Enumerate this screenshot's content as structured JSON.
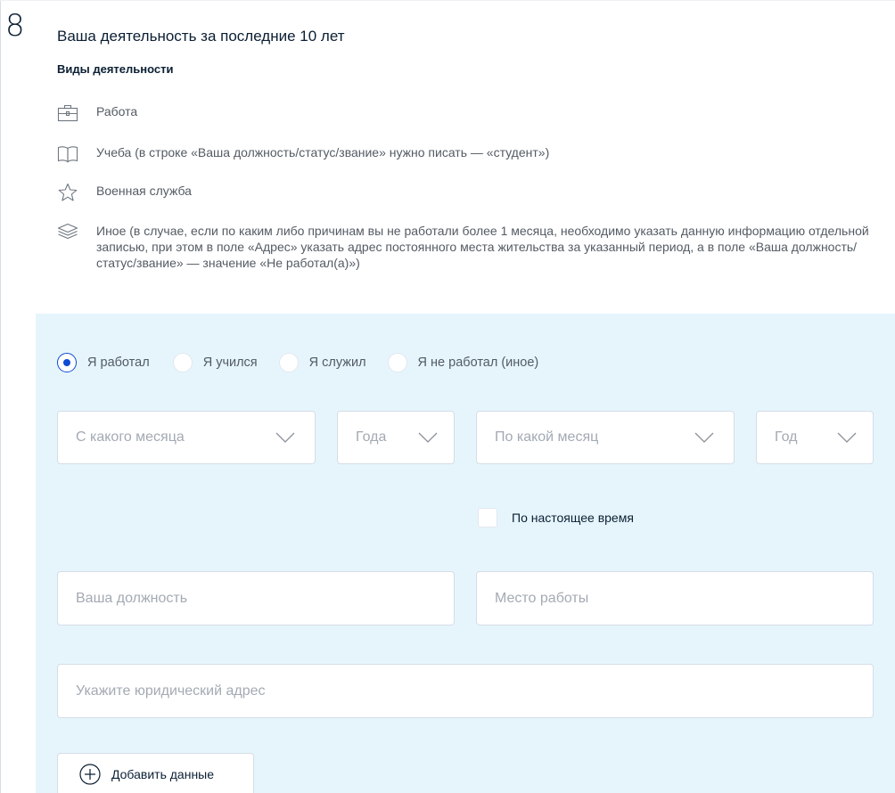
{
  "step": {
    "number": "8",
    "title": "Ваша деятельность за последние 10 лет"
  },
  "activity_types": {
    "heading": "Виды деятельности",
    "items": [
      {
        "icon": "briefcase-icon",
        "text": "Работа"
      },
      {
        "icon": "book-icon",
        "text": "Учеба (в строке «Ваша должность/статус/звание» нужно писать — «студент»)"
      },
      {
        "icon": "star-icon",
        "text": "Военная служба"
      },
      {
        "icon": "layers-icon",
        "text": "Иное (в случае, если по каким либо причинам вы не работали более 1 месяца, необходимо указать данную информацию отдельной записью, при этом в поле «Адрес» указать адрес постоянного места жительства за указанный период, а в поле «Ваша должность/статус/звание» — значение «Не работал(а)»)"
      }
    ]
  },
  "form": {
    "activity_options": [
      {
        "label": "Я работал",
        "checked": true
      },
      {
        "label": "Я учился",
        "checked": false
      },
      {
        "label": "Я служил",
        "checked": false
      },
      {
        "label": "Я не работал (иное)",
        "checked": false
      }
    ],
    "from_month": {
      "placeholder": "С какого месяца"
    },
    "from_year": {
      "placeholder": "Года"
    },
    "to_month": {
      "placeholder": "По какой месяц"
    },
    "to_year": {
      "placeholder": "Год"
    },
    "present_checkbox": {
      "label": "По настоящее время",
      "checked": false
    },
    "position": {
      "placeholder": "Ваша должность"
    },
    "workplace": {
      "placeholder": "Место работы"
    },
    "legal_address": {
      "placeholder": "Укажите юридический адрес"
    },
    "add_button": {
      "label": "Добавить данные",
      "icon": "plus-circle-icon"
    }
  },
  "colors": {
    "accent": "#0d4cd3",
    "panel_background": "#e6f5fc",
    "placeholder_text": "#a3aab3",
    "body_text": "#535b63"
  }
}
